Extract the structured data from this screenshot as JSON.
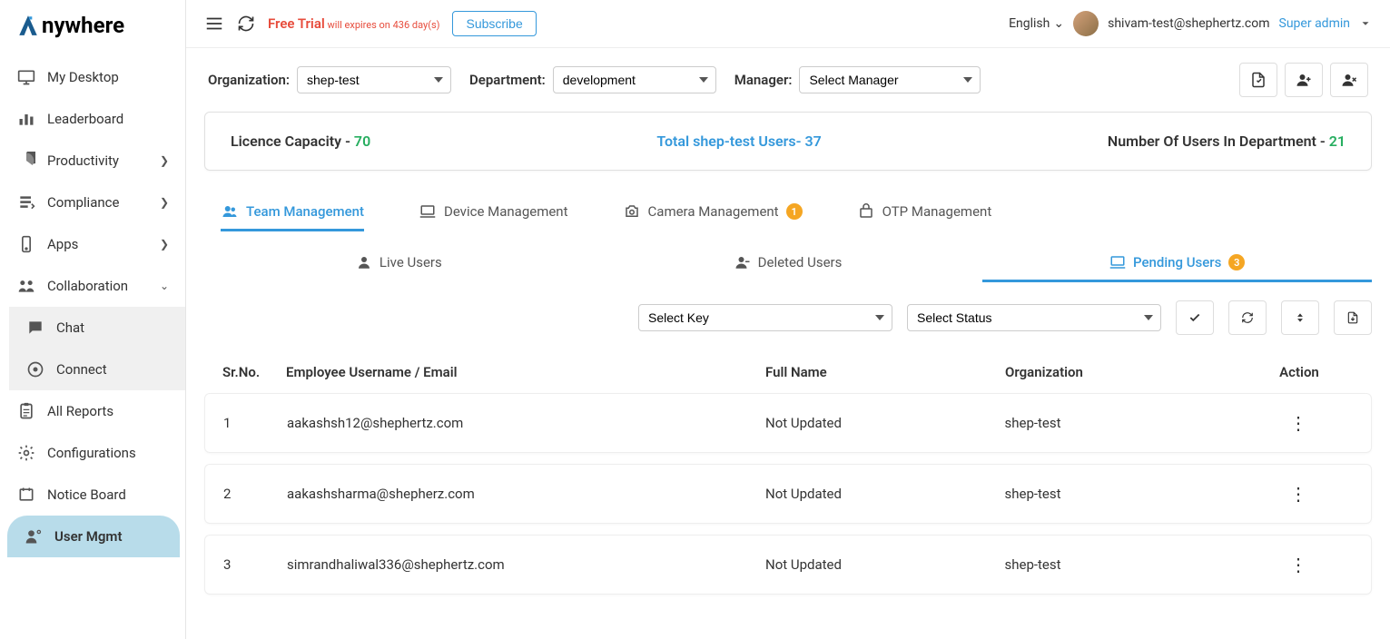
{
  "brand": "nywhere",
  "topbar": {
    "trial_label": "Free Trial",
    "trial_suffix": " will expires on 436 day(s)",
    "subscribe": "Subscribe",
    "language": "English",
    "user_email": "shivam-test@shephertz.com",
    "role": "Super admin"
  },
  "sidebar": {
    "items": [
      {
        "label": "My Desktop"
      },
      {
        "label": "Leaderboard"
      },
      {
        "label": "Productivity"
      },
      {
        "label": "Compliance"
      },
      {
        "label": "Apps"
      },
      {
        "label": "Collaboration"
      },
      {
        "label": "Chat"
      },
      {
        "label": "Connect"
      },
      {
        "label": "All Reports"
      },
      {
        "label": "Configurations"
      },
      {
        "label": "Notice Board"
      },
      {
        "label": "User Mgmt"
      }
    ]
  },
  "filters": {
    "org_label": "Organization:",
    "org_value": "shep-test",
    "dept_label": "Department:",
    "dept_value": "development",
    "mgr_label": "Manager:",
    "mgr_value": "Select Manager"
  },
  "stats": {
    "licence_label": "Licence Capacity - ",
    "licence_value": "70",
    "total_label": "Total shep-test Users- ",
    "total_value": "37",
    "dept_users_label": "Number Of Users In Department - ",
    "dept_users_value": "21"
  },
  "tabs": {
    "team": "Team Management",
    "device": "Device Management",
    "camera": "Camera Management",
    "camera_badge": "1",
    "otp": "OTP Management"
  },
  "subtabs": {
    "live": "Live Users",
    "deleted": "Deleted Users",
    "pending": "Pending Users",
    "pending_badge": "3"
  },
  "table_filters": {
    "key": "Select Key",
    "status": "Select Status"
  },
  "table": {
    "headers": {
      "sr": "Sr.No.",
      "email": "Employee Username / Email",
      "name": "Full Name",
      "org": "Organization",
      "action": "Action"
    },
    "rows": [
      {
        "sr": "1",
        "email": "aakashsh12@shephertz.com",
        "name": "Not Updated",
        "org": "shep-test"
      },
      {
        "sr": "2",
        "email": "aakashsharma@shepherz.com",
        "name": "Not Updated",
        "org": "shep-test"
      },
      {
        "sr": "3",
        "email": "simrandhaliwal336@shephertz.com",
        "name": "Not Updated",
        "org": "shep-test"
      }
    ]
  }
}
